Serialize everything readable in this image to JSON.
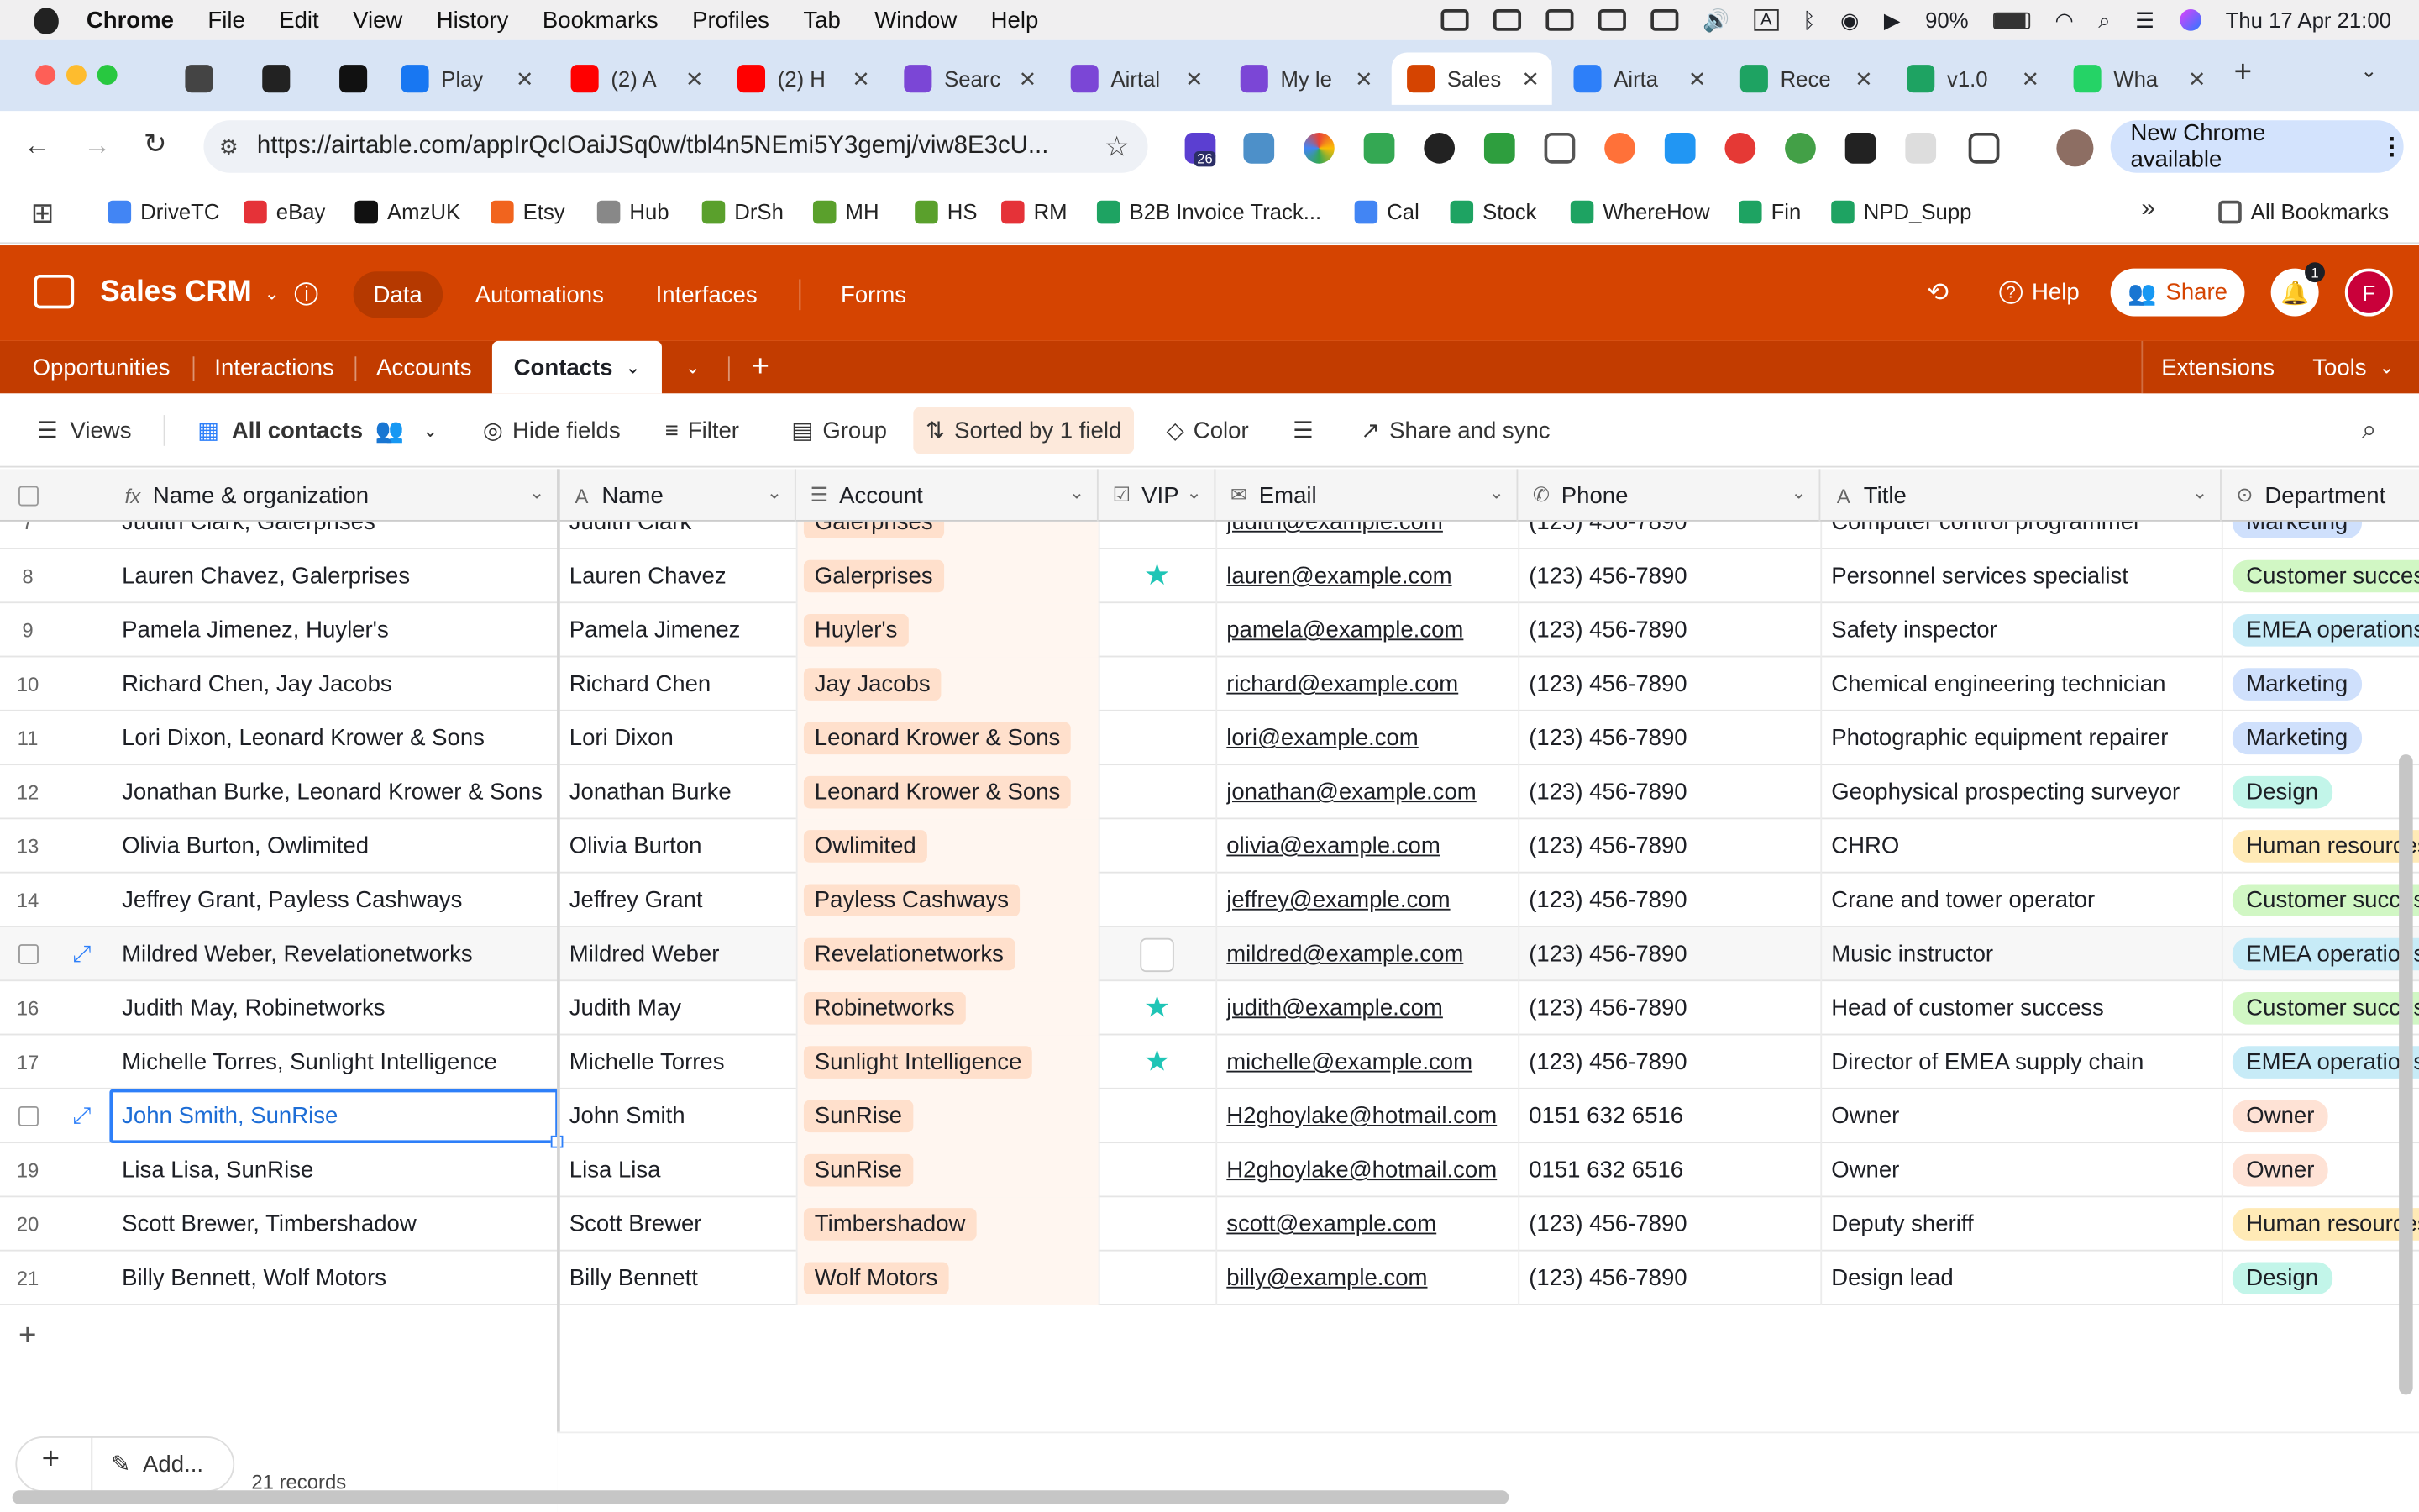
{
  "menubar": {
    "app": "Chrome",
    "items": [
      "File",
      "Edit",
      "View",
      "History",
      "Bookmarks",
      "Profiles",
      "Tab",
      "Window",
      "Help"
    ],
    "battery": "90%",
    "datetime": "Thu 17 Apr  21:00"
  },
  "tabs": [
    {
      "label": "",
      "color": "#444"
    },
    {
      "label": "",
      "color": "#222"
    },
    {
      "label": "",
      "color": "#111"
    },
    {
      "label": "Play",
      "color": "#1877f2"
    },
    {
      "label": "(2) A",
      "color": "#ff0000"
    },
    {
      "label": "(2) H",
      "color": "#ff0000"
    },
    {
      "label": "Searc",
      "color": "#7b46d6"
    },
    {
      "label": "Airtal",
      "color": "#7b46d6"
    },
    {
      "label": "My le",
      "color": "#7b46d6"
    },
    {
      "label": "Sales",
      "color": "#d54401"
    },
    {
      "label": "Airta",
      "color": "#2d7ff9"
    },
    {
      "label": "Rece",
      "color": "#1ea362"
    },
    {
      "label": "v1.0",
      "color": "#1ea362"
    },
    {
      "label": "Wha",
      "color": "#25d366"
    }
  ],
  "address": {
    "url": "https://airtable.com/appIrQcIOaiJSq0w/tbl4n5NEmi5Y3gemj/viw8E3cU...",
    "new_chrome": "New Chrome available",
    "ext_badge": "26"
  },
  "bookmarks": [
    {
      "label": "DriveTC",
      "color": "#4285f4"
    },
    {
      "label": "eBay",
      "color": "#e53238"
    },
    {
      "label": "AmzUK",
      "color": "#111"
    },
    {
      "label": "Etsy",
      "color": "#f1641e"
    },
    {
      "label": "Hub",
      "color": "#888"
    },
    {
      "label": "DrSh",
      "color": "#5aa02c"
    },
    {
      "label": "MH",
      "color": "#5aa02c"
    },
    {
      "label": "HS",
      "color": "#5aa02c"
    },
    {
      "label": "RM",
      "color": "#e53238"
    },
    {
      "label": "B2B Invoice Track...",
      "color": "#1ea362"
    },
    {
      "label": "Cal",
      "color": "#4285f4"
    },
    {
      "label": "Stock",
      "color": "#1ea362"
    },
    {
      "label": "WhereHow",
      "color": "#1ea362"
    },
    {
      "label": "Fin",
      "color": "#1ea362"
    },
    {
      "label": "NPD_Supp",
      "color": "#1ea362"
    }
  ],
  "bookmarks_all": "All Bookmarks",
  "base": {
    "name": "Sales CRM",
    "nav": [
      "Data",
      "Automations",
      "Interfaces",
      "Forms"
    ],
    "help": "Help",
    "share": "Share",
    "notif_count": "1",
    "avatar_letter": "F",
    "brand_color": "#d54401"
  },
  "tables": {
    "items": [
      "Opportunities",
      "Interactions",
      "Accounts",
      "Contacts"
    ],
    "extensions": "Extensions",
    "tools": "Tools"
  },
  "toolbar": {
    "views": "Views",
    "view_name": "All contacts",
    "hide_fields": "Hide fields",
    "filter": "Filter",
    "group": "Group",
    "sort": "Sorted by 1 field",
    "color": "Color",
    "share_sync": "Share and sync"
  },
  "columns": [
    "Name & organization",
    "Name",
    "Account",
    "VIP",
    "Email",
    "Phone",
    "Title",
    "Department"
  ],
  "rows": [
    {
      "num": "7",
      "nameorg": "Judith Clark, Galerprises",
      "name": "Judith Clark",
      "account": "Galerprises",
      "vip": false,
      "email": "judith@example.com",
      "phone": "(123) 456-7890",
      "title": "Computer control programmer",
      "dept": "Marketing",
      "dept_color": "#cfe0fc"
    },
    {
      "num": "8",
      "nameorg": "Lauren Chavez, Galerprises",
      "name": "Lauren Chavez",
      "account": "Galerprises",
      "vip": true,
      "email": "lauren@example.com",
      "phone": "(123) 456-7890",
      "title": "Personnel services specialist",
      "dept": "Customer success",
      "dept_color": "#d1f7c4"
    },
    {
      "num": "9",
      "nameorg": "Pamela Jimenez, Huyler's",
      "name": "Pamela Jimenez",
      "account": "Huyler's",
      "vip": false,
      "email": "pamela@example.com",
      "phone": "(123) 456-7890",
      "title": "Safety inspector",
      "dept": "EMEA operations",
      "dept_color": "#c7ebf7"
    },
    {
      "num": "10",
      "nameorg": "Richard Chen, Jay Jacobs",
      "name": "Richard Chen",
      "account": "Jay Jacobs",
      "vip": false,
      "email": "richard@example.com",
      "phone": "(123) 456-7890",
      "title": "Chemical engineering technician",
      "dept": "Marketing",
      "dept_color": "#cfe0fc"
    },
    {
      "num": "11",
      "nameorg": "Lori Dixon, Leonard Krower & Sons",
      "name": "Lori Dixon",
      "account": "Leonard Krower & Sons",
      "vip": false,
      "email": "lori@example.com",
      "phone": "(123) 456-7890",
      "title": "Photographic equipment repairer",
      "dept": "Marketing",
      "dept_color": "#cfe0fc"
    },
    {
      "num": "12",
      "nameorg": "Jonathan Burke, Leonard Krower & Sons",
      "name": "Jonathan Burke",
      "account": "Leonard Krower & Sons",
      "vip": false,
      "email": "jonathan@example.com",
      "phone": "(123) 456-7890",
      "title": "Geophysical prospecting surveyor",
      "dept": "Design",
      "dept_color": "#c2f5e9"
    },
    {
      "num": "13",
      "nameorg": "Olivia Burton, Owlimited",
      "name": "Olivia Burton",
      "account": "Owlimited",
      "vip": false,
      "email": "olivia@example.com",
      "phone": "(123) 456-7890",
      "title": "CHRO",
      "dept": "Human resources",
      "dept_color": "#ffeab6"
    },
    {
      "num": "14",
      "nameorg": "Jeffrey Grant, Payless Cashways",
      "name": "Jeffrey Grant",
      "account": "Payless Cashways",
      "vip": false,
      "email": "jeffrey@example.com",
      "phone": "(123) 456-7890",
      "title": "Crane and tower operator",
      "dept": "Customer success",
      "dept_color": "#d1f7c4"
    },
    {
      "num": "",
      "nameorg": "Mildred Weber, Revelationetworks",
      "name": "Mildred Weber",
      "account": "Revelationetworks",
      "vip": false,
      "email": "mildred@example.com",
      "phone": "(123) 456-7890",
      "title": "Music instructor",
      "dept": "EMEA operations",
      "dept_color": "#c7ebf7"
    },
    {
      "num": "16",
      "nameorg": "Judith May, Robinetworks",
      "name": "Judith May",
      "account": "Robinetworks",
      "vip": true,
      "email": "judith@example.com",
      "phone": "(123) 456-7890",
      "title": "Head of customer success",
      "dept": "Customer success",
      "dept_color": "#d1f7c4"
    },
    {
      "num": "17",
      "nameorg": "Michelle Torres, Sunlight Intelligence",
      "name": "Michelle Torres",
      "account": "Sunlight Intelligence",
      "vip": true,
      "email": "michelle@example.com",
      "phone": "(123) 456-7890",
      "title": "Director of EMEA supply chain",
      "dept": "EMEA operations",
      "dept_color": "#c7ebf7"
    },
    {
      "num": "",
      "nameorg": "John Smith, SunRise",
      "name": "John Smith",
      "account": "SunRise",
      "vip": false,
      "email": "H2ghoylake@hotmail.com",
      "phone": "0151 632 6516",
      "title": "Owner",
      "dept": "Owner",
      "dept_color": "#fee2d5"
    },
    {
      "num": "19",
      "nameorg": "Lisa Lisa, SunRise",
      "name": "Lisa Lisa",
      "account": "SunRise",
      "vip": false,
      "email": "H2ghoylake@hotmail.com",
      "phone": "0151 632 6516",
      "title": "Owner",
      "dept": "Owner",
      "dept_color": "#fee2d5"
    },
    {
      "num": "20",
      "nameorg": "Scott Brewer, Timbershadow",
      "name": "Scott Brewer",
      "account": "Timbershadow",
      "vip": false,
      "email": "scott@example.com",
      "phone": "(123) 456-7890",
      "title": "Deputy sheriff",
      "dept": "Human resources",
      "dept_color": "#ffeab6"
    },
    {
      "num": "21",
      "nameorg": "Billy Bennett, Wolf Motors",
      "name": "Billy Bennett",
      "account": "Wolf Motors",
      "vip": false,
      "email": "billy@example.com",
      "phone": "(123) 456-7890",
      "title": "Design lead",
      "dept": "Design",
      "dept_color": "#c2f5e9"
    }
  ],
  "footer": {
    "add_label": "Add...",
    "records": "21 records"
  }
}
